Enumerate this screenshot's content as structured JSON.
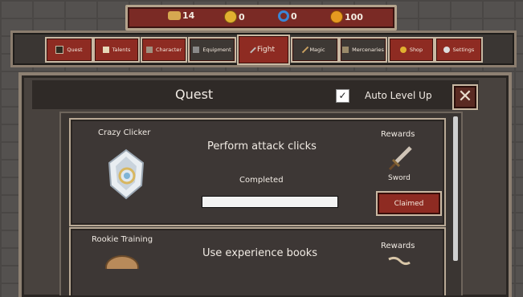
{
  "resources": [
    {
      "icon": "bread-icon",
      "value": "14",
      "color": "#d6a850"
    },
    {
      "icon": "gold-coin-icon",
      "value": "0",
      "color": "#e0b030"
    },
    {
      "icon": "blue-swirl-icon",
      "value": "0",
      "color": "#3a86d6"
    },
    {
      "icon": "orange-coin-icon",
      "value": "100",
      "color": "#e59a20"
    }
  ],
  "nav": {
    "tabs": [
      "Quest",
      "Talents",
      "Character",
      "Equipment",
      "Fight",
      "Magic",
      "Mercenaries",
      "Shop",
      "Settings"
    ]
  },
  "dialog": {
    "title": "Quest",
    "auto_level_label": "Auto Level Up",
    "auto_level_checked": "✓",
    "close_glyph": "✕"
  },
  "quests": [
    {
      "name": "Crazy Clicker",
      "task": "Perform attack clicks",
      "status": "Completed",
      "progress": 1.0,
      "rewards_label": "Rewards",
      "reward_item": "Sword",
      "button": "Claimed"
    },
    {
      "name": "Rookie Training",
      "task": "Use experience books",
      "rewards_label": "Rewards"
    }
  ],
  "colors": {
    "accent": "#8e2b22",
    "frame": "#b9a995"
  }
}
